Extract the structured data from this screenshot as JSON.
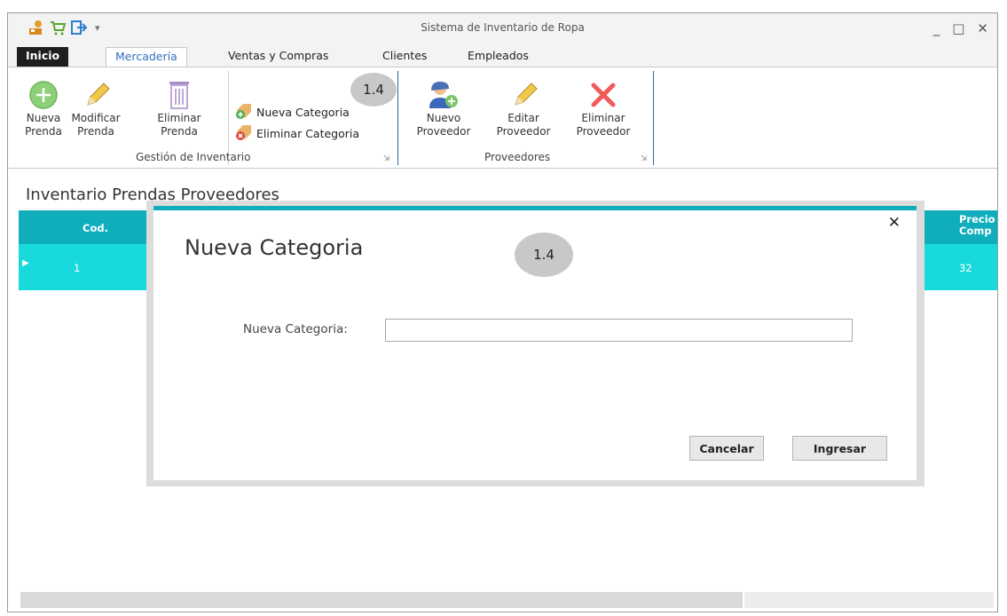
{
  "window": {
    "title": "Sistema de Inventario de Ropa",
    "controls": {
      "minimize": "_",
      "maximize": "□",
      "close": "✕"
    }
  },
  "quick_access": {
    "icons": [
      "save-person-icon",
      "cart-icon",
      "exit-icon"
    ],
    "customize": "▾"
  },
  "tabs": {
    "inicio": "Inicio",
    "mercaderia": "Mercadería",
    "ventas": "Ventas y Compras",
    "clientes": "Clientes",
    "empleados": "Empleados"
  },
  "ribbon": {
    "inventario": {
      "nueva_prenda": {
        "line1": "Nueva",
        "line2": "Prenda"
      },
      "modificar_prenda": {
        "line1": "Modificar",
        "line2": "Prenda"
      },
      "eliminar_prenda": {
        "line1": "Eliminar",
        "line2": "Prenda"
      },
      "nueva_categoria": "Nueva Categoria",
      "eliminar_categoria": "Eliminar Categoria",
      "group_label": "Gestión de Inventario"
    },
    "proveedores": {
      "nuevo": {
        "line1": "Nuevo",
        "line2": "Proveedor"
      },
      "editar": {
        "line1": "Editar",
        "line2": "Proveedor"
      },
      "eliminar": {
        "line1": "Eliminar",
        "line2": "Proveedor"
      },
      "group_label": "Proveedores"
    },
    "step_badge": "1.4",
    "launcher": "⇲"
  },
  "content": {
    "title": "Inventario Prendas  Proveedores",
    "grid": {
      "header_cod": "Cod.",
      "header_precio": "Precio Comp",
      "row": {
        "indicator": "▶",
        "cod": "1",
        "precio": "32"
      }
    }
  },
  "dialog": {
    "title": "Nueva Categoria",
    "step_badge": "1.4",
    "close": "✕",
    "field_label": "Nueva Categoria:",
    "field_value": "",
    "cancel_label": "Cancelar",
    "submit_label": "Ingresar"
  },
  "colors": {
    "accent": "#10aebd",
    "row_highlight": "#18d9dc",
    "ribbon_active_tab": "#2f6fbd",
    "separator": "#2f5fb0"
  }
}
